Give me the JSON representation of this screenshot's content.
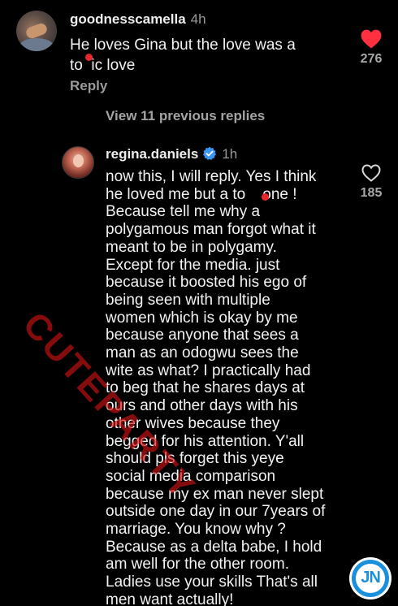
{
  "thread": {
    "view_previous": "View 11 previous replies"
  },
  "comment1": {
    "username": "goodnesscamella",
    "time": "4h",
    "text_lines": [
      "He loves Gina but the love was a",
      "to  ic love"
    ],
    "reply_label": "Reply",
    "likes": "276",
    "liked": true,
    "heart_icon": "heart-filled-icon",
    "heart_color": "#ff3040"
  },
  "comment2": {
    "username": "regina.daniels",
    "verified": true,
    "verified_color": "#3897f0",
    "time": "1h",
    "likes": "185",
    "liked": false,
    "heart_icon": "heart-outline-icon",
    "text_lines": [
      "now this, I will reply. Yes I think",
      "he loved me but a to    one !",
      "Because tell me why a",
      "polygamous man forgot what it",
      "meant to be in polygamy.",
      "Except for the media. just",
      "because it boosted his ego of",
      "being seen with multiple",
      "women which is okay by me",
      "because anyone that sees a",
      "man as an odogwu sees the",
      "wite as what? I practically had",
      "to beg that he shares days at",
      "ours and other days with his",
      "other wives because they",
      "begged for his attention. Y'all",
      "should pls forget this yeye",
      "social media comparison",
      "because my ex man never slept",
      "outside one day in our 7years of",
      "marriage. You know why ?",
      "Because as a delta babe, I hold",
      "am well for the other room.",
      "Ladies use your skills That's all",
      "men want actually!"
    ]
  },
  "overlay": {
    "watermark_text": "CUTEPARTY",
    "watermark_color": "#d71414",
    "censor_dot_color": "#e8262e"
  },
  "logo": {
    "text": "JN",
    "color": "#1a8fdc"
  }
}
